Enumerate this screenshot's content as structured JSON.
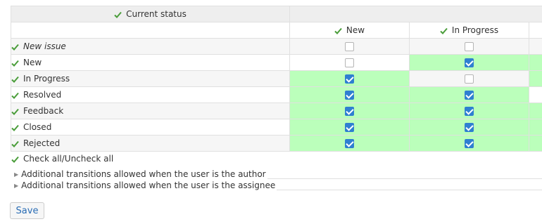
{
  "header": {
    "current_status_label": "Current status"
  },
  "columns": [
    {
      "label": "New"
    },
    {
      "label": "In Progress"
    }
  ],
  "rows": [
    {
      "label": "New issue",
      "italic": true,
      "cells": [
        false,
        false
      ]
    },
    {
      "label": "New",
      "italic": false,
      "cells": [
        false,
        true
      ]
    },
    {
      "label": "In Progress",
      "italic": false,
      "cells": [
        true,
        false
      ]
    },
    {
      "label": "Resolved",
      "italic": false,
      "cells": [
        true,
        true
      ]
    },
    {
      "label": "Feedback",
      "italic": false,
      "cells": [
        true,
        true
      ]
    },
    {
      "label": "Closed",
      "italic": false,
      "cells": [
        true,
        true
      ]
    },
    {
      "label": "Rejected",
      "italic": false,
      "cells": [
        true,
        true
      ]
    }
  ],
  "green_states": [
    [
      false,
      false,
      false
    ],
    [
      false,
      true,
      true
    ],
    [
      true,
      false,
      true
    ],
    [
      true,
      true,
      false
    ],
    [
      true,
      true,
      true
    ],
    [
      true,
      true,
      true
    ],
    [
      true,
      true,
      true
    ]
  ],
  "check_all_label": "Check all/Uncheck all",
  "fieldsets": [
    {
      "label": "Additional transitions allowed when the user is the author"
    },
    {
      "label": "Additional transitions allowed when the user is the assignee"
    }
  ],
  "save_label": "Save",
  "colors": {
    "check_green": "#4a9d3a",
    "allowed_cell_bg": "#bbffbb",
    "checkbox_checked": "#2f7fd1",
    "link_blue": "#2a6db5"
  },
  "icons": {
    "check": "check-icon",
    "collapsed": "triangle-right-icon"
  }
}
